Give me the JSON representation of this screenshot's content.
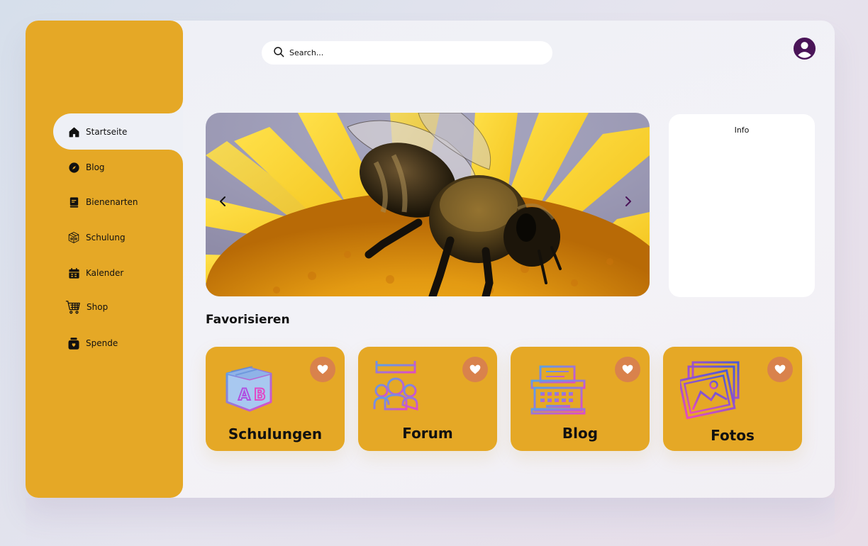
{
  "search": {
    "placeholder": "Search..."
  },
  "sidebar": {
    "items": [
      {
        "label": "Startseite",
        "icon": "home-icon",
        "active": true
      },
      {
        "label": "Blog",
        "icon": "compass-icon"
      },
      {
        "label": "Bienenarten",
        "icon": "book-icon"
      },
      {
        "label": "Schulung",
        "icon": "box-icon"
      },
      {
        "label": "Kalender",
        "icon": "calendar-icon"
      },
      {
        "label": "Shop",
        "icon": "cart-icon"
      },
      {
        "label": "Spende",
        "icon": "donation-jar-icon"
      }
    ]
  },
  "hero": {
    "image": "bee-on-sunflower"
  },
  "info": {
    "title": "Info"
  },
  "favorites": {
    "title": "Favorisieren",
    "cards": [
      {
        "label": "Schulungen",
        "icon": "ab-block-icon"
      },
      {
        "label": "Forum",
        "icon": "people-icon"
      },
      {
        "label": "Blog",
        "icon": "typewriter-icon"
      },
      {
        "label": "Fotos",
        "icon": "photos-icon"
      }
    ]
  },
  "colors": {
    "sidebar": "#e5a826",
    "card": "#e5a826",
    "heart_badge": "#d9824c",
    "avatar": "#4a1458",
    "background": "#eef0f6"
  }
}
